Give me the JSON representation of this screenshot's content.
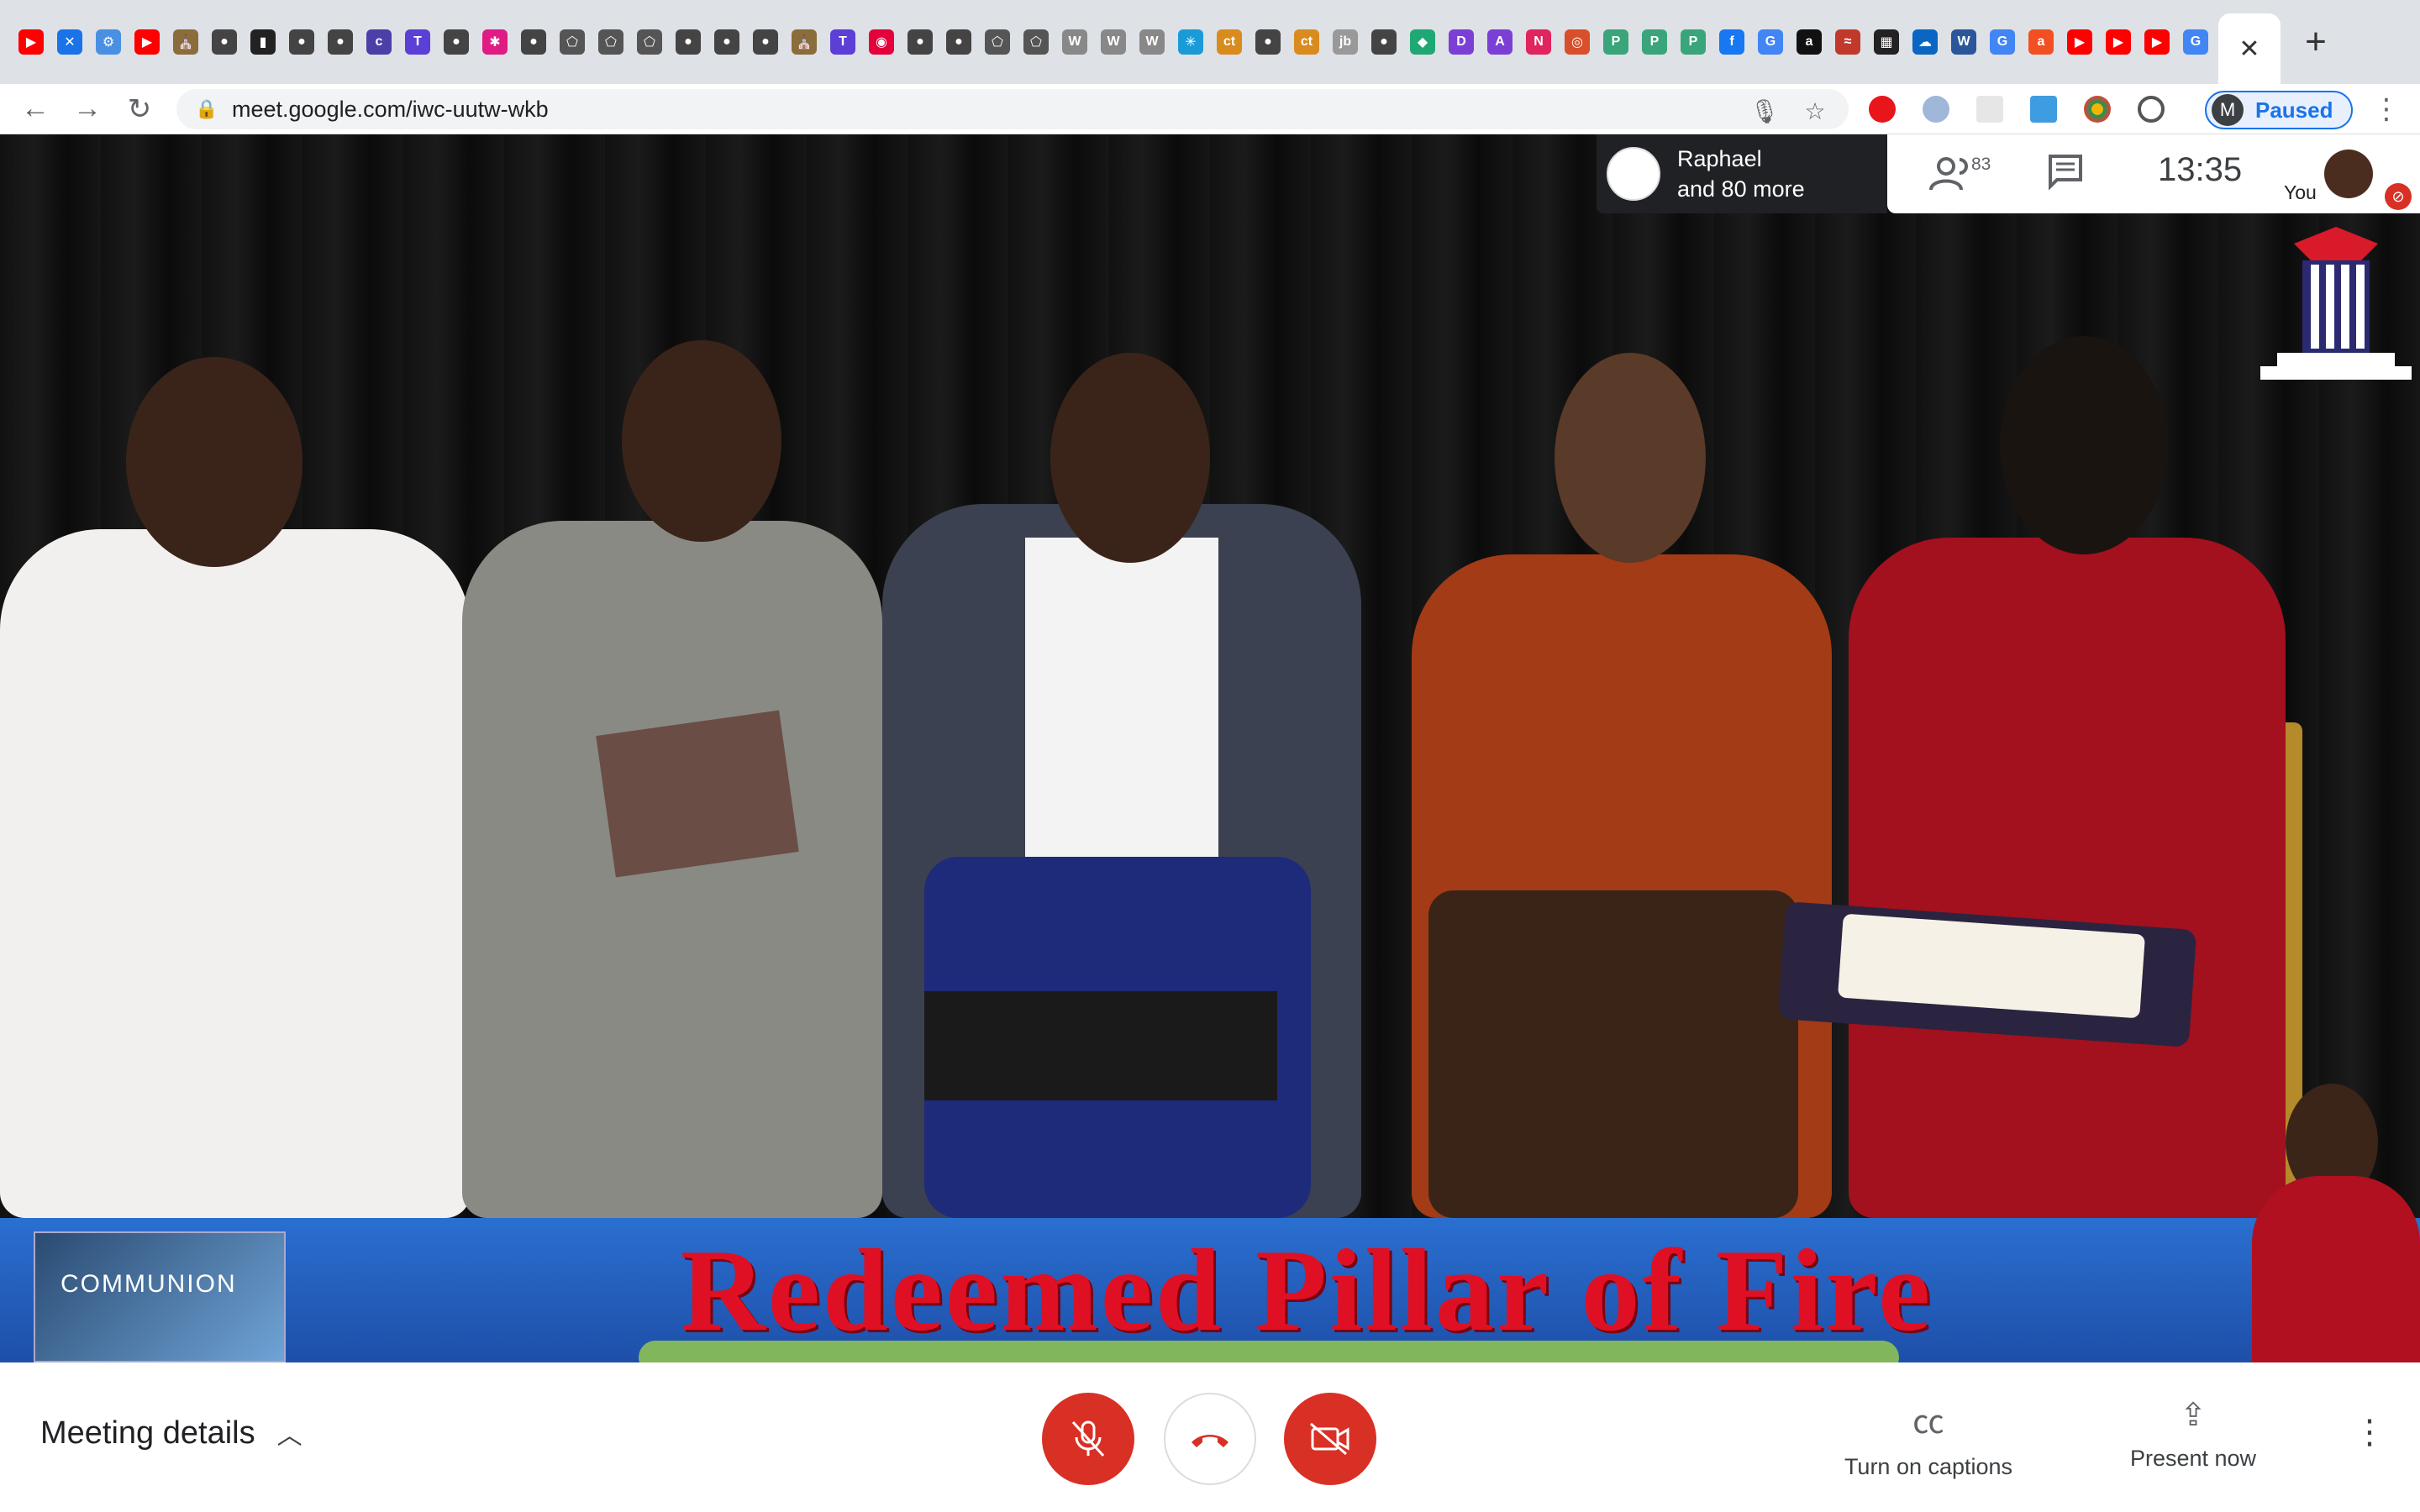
{
  "browser": {
    "active_tab_close": "✕",
    "new_tab": "+",
    "url": "meet.google.com/iwc-uutw-wkb",
    "profile_initial": "M",
    "profile_status": "Paused",
    "favicons": [
      {
        "glyph": "▶",
        "color": "#ff0000"
      },
      {
        "glyph": "✕",
        "color": "#1a73e8"
      },
      {
        "glyph": "⚙",
        "color": "#4a90e2"
      },
      {
        "glyph": "▶",
        "color": "#ff0000"
      },
      {
        "glyph": "⛪",
        "color": "#8a6d3b"
      },
      {
        "glyph": "●",
        "color": "#444"
      },
      {
        "glyph": "▮",
        "color": "#222"
      },
      {
        "glyph": "●",
        "color": "#444"
      },
      {
        "glyph": "●",
        "color": "#444"
      },
      {
        "glyph": "c",
        "color": "#4b3fa8"
      },
      {
        "glyph": "T",
        "color": "#5b3fd6"
      },
      {
        "glyph": "●",
        "color": "#444"
      },
      {
        "glyph": "✱",
        "color": "#e01b84"
      },
      {
        "glyph": "●",
        "color": "#444"
      },
      {
        "glyph": "⬠",
        "color": "#555"
      },
      {
        "glyph": "⬠",
        "color": "#555"
      },
      {
        "glyph": "⬠",
        "color": "#555"
      },
      {
        "glyph": "●",
        "color": "#444"
      },
      {
        "glyph": "●",
        "color": "#444"
      },
      {
        "glyph": "●",
        "color": "#444"
      },
      {
        "glyph": "⛪",
        "color": "#8a6d3b"
      },
      {
        "glyph": "T",
        "color": "#5b3fd6"
      },
      {
        "glyph": "◉",
        "color": "#e4003a"
      },
      {
        "glyph": "●",
        "color": "#444"
      },
      {
        "glyph": "●",
        "color": "#444"
      },
      {
        "glyph": "⬠",
        "color": "#555"
      },
      {
        "glyph": "⬠",
        "color": "#555"
      },
      {
        "glyph": "W",
        "color": "#888"
      },
      {
        "glyph": "W",
        "color": "#888"
      },
      {
        "glyph": "W",
        "color": "#888"
      },
      {
        "glyph": "✳",
        "color": "#1a9bd7"
      },
      {
        "glyph": "ct",
        "color": "#d98b1e"
      },
      {
        "glyph": "●",
        "color": "#444"
      },
      {
        "glyph": "ct",
        "color": "#d98b1e"
      },
      {
        "glyph": "jb",
        "color": "#999"
      },
      {
        "glyph": "●",
        "color": "#444"
      },
      {
        "glyph": "◆",
        "color": "#1fa774"
      },
      {
        "glyph": "D",
        "color": "#7b3fd6"
      },
      {
        "glyph": "A",
        "color": "#7b3fd6"
      },
      {
        "glyph": "N",
        "color": "#e0245e"
      },
      {
        "glyph": "◎",
        "color": "#d94f2b"
      },
      {
        "glyph": "P",
        "color": "#3aa57a"
      },
      {
        "glyph": "P",
        "color": "#3aa57a"
      },
      {
        "glyph": "P",
        "color": "#3aa57a"
      },
      {
        "glyph": "f",
        "color": "#1877f2"
      },
      {
        "glyph": "G",
        "color": "#4285f4"
      },
      {
        "glyph": "a",
        "color": "#111"
      },
      {
        "glyph": "≈",
        "color": "#c0392b"
      },
      {
        "glyph": "▦",
        "color": "#222"
      },
      {
        "glyph": "☁",
        "color": "#0a66c2"
      },
      {
        "glyph": "W",
        "color": "#2b579a"
      },
      {
        "glyph": "G",
        "color": "#4285f4"
      },
      {
        "glyph": "a",
        "color": "#f25022"
      },
      {
        "glyph": "▶",
        "color": "#ff0000"
      },
      {
        "glyph": "▶",
        "color": "#ff0000"
      },
      {
        "glyph": "▶",
        "color": "#ff0000"
      },
      {
        "glyph": "G",
        "color": "#4285f4"
      }
    ]
  },
  "meet": {
    "participant_name": "Raphael",
    "participant_more": "and 80 more",
    "people_count": "83",
    "time": "13:35",
    "you_label": "You"
  },
  "stream": {
    "banner_title": "Redeemed Pillar of Fire",
    "communion_label": "COMMUNION"
  },
  "bottom_bar": {
    "meeting_details": "Meeting details",
    "captions_label": "Turn on captions",
    "present_label": "Present now"
  }
}
